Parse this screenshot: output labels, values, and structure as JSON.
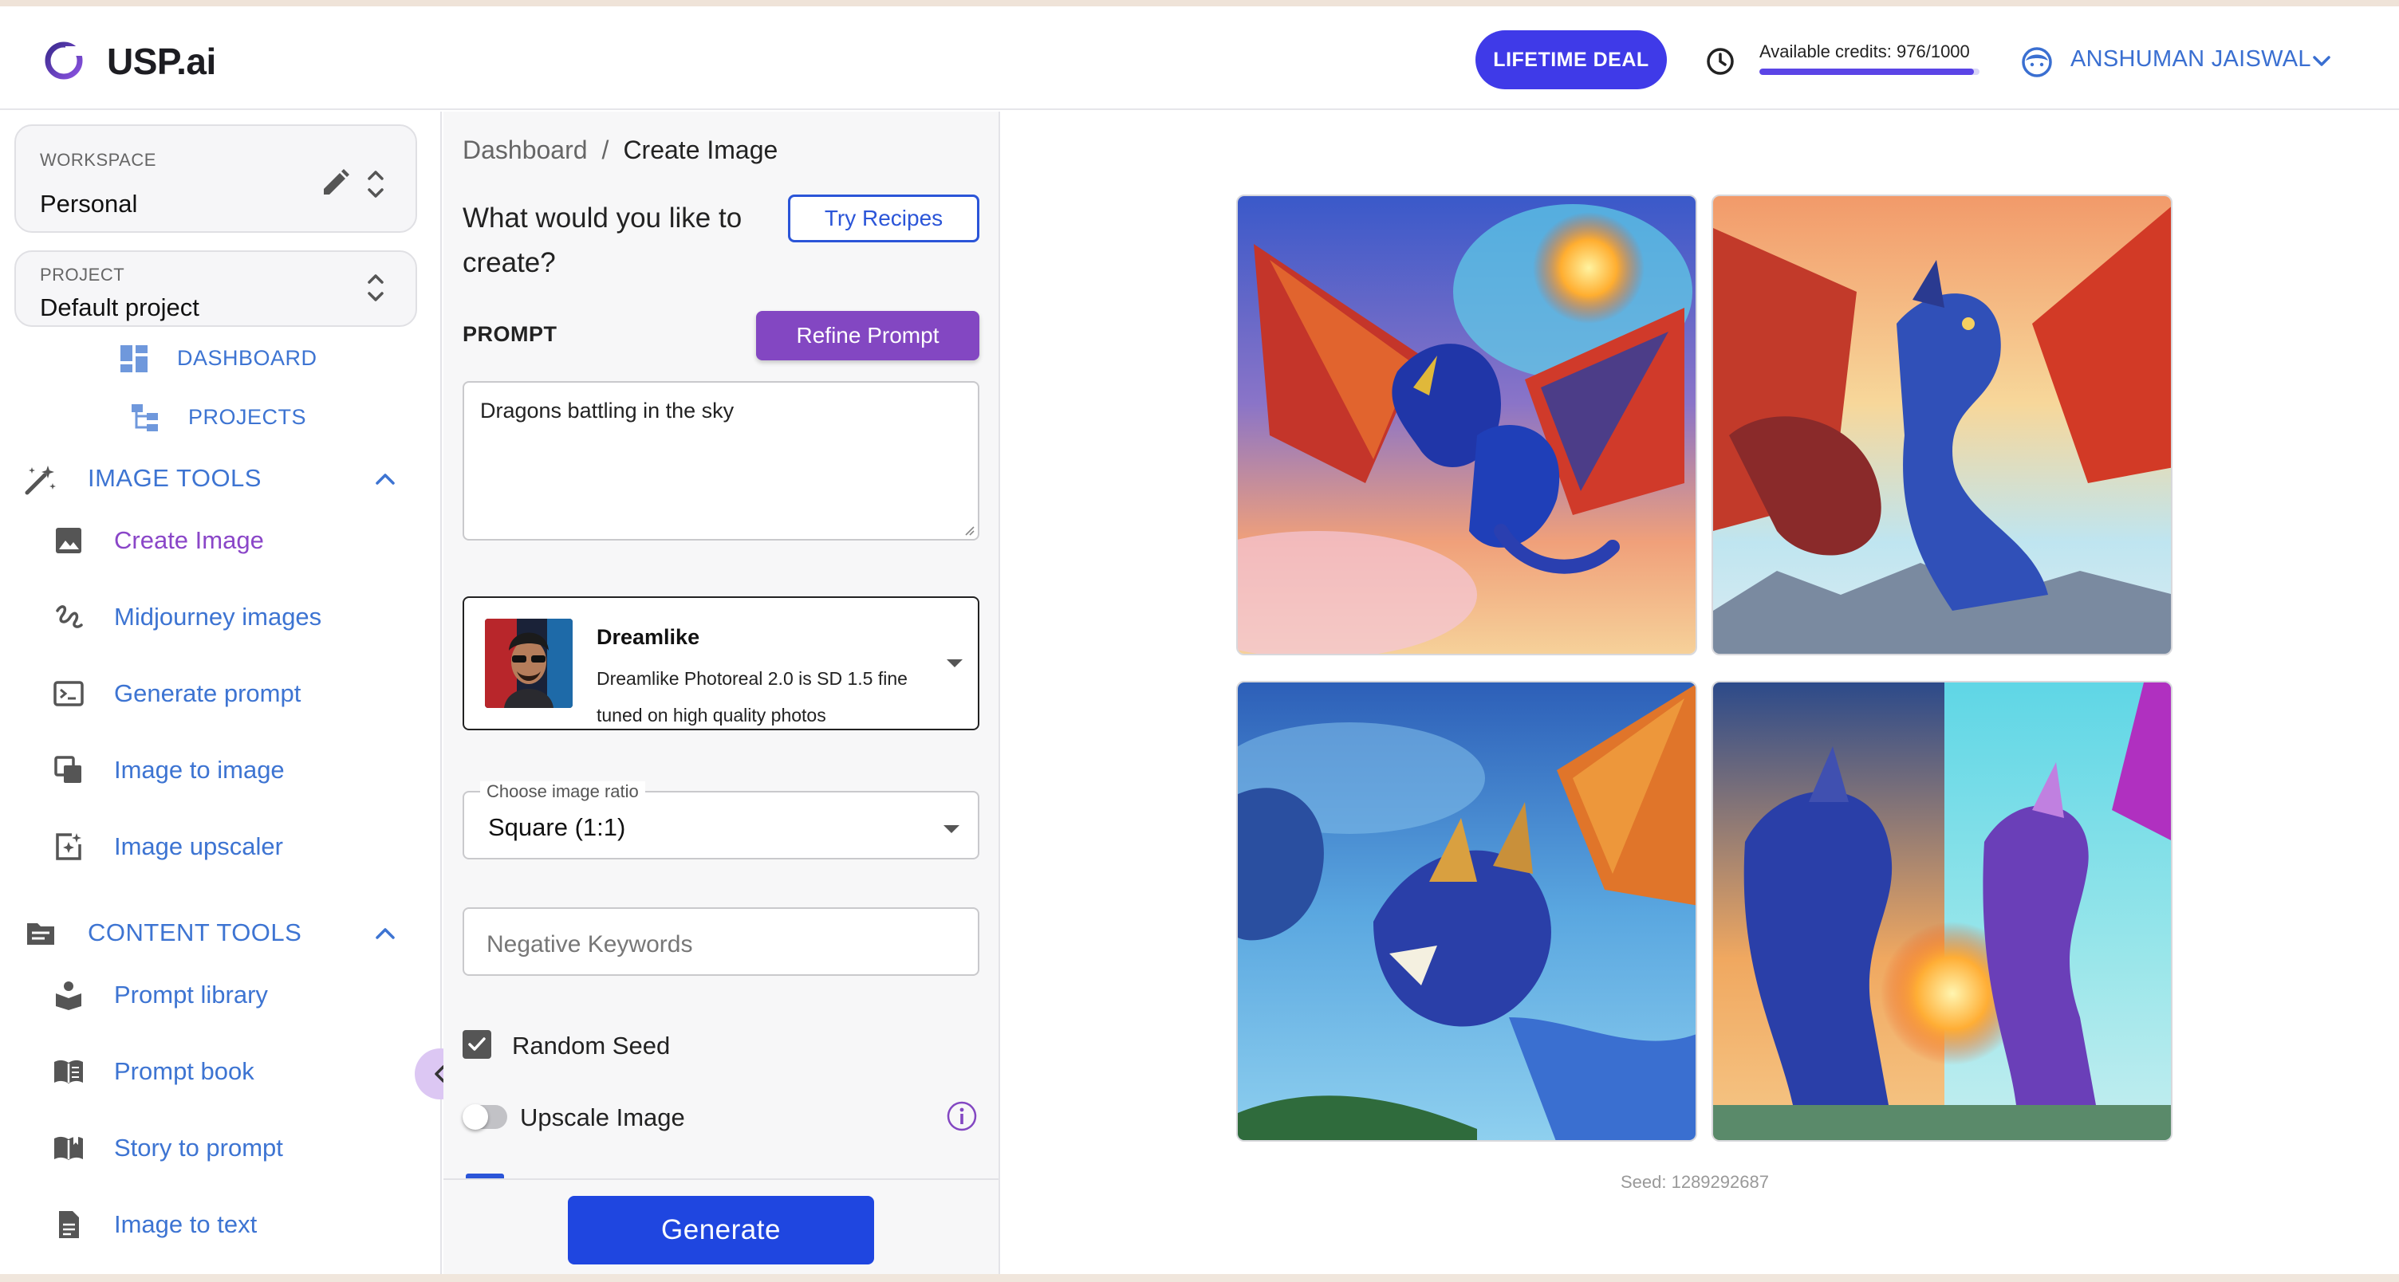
{
  "app": {
    "name": "USP.ai"
  },
  "header": {
    "deal_label": "LIFETIME DEAL",
    "credits_text": "Available credits: 976/1000",
    "credits_fraction": 0.976,
    "user_name": "ANSHUMAN JAISWAL"
  },
  "sidebar": {
    "workspace_label": "WORKSPACE",
    "workspace_value": "Personal",
    "project_label": "PROJECT",
    "project_value": "Default project",
    "links": [
      {
        "label": "DASHBOARD",
        "icon": "dashboard-icon"
      },
      {
        "label": "PROJECTS",
        "icon": "projects-icon"
      }
    ],
    "image_tools": {
      "title": "IMAGE TOOLS",
      "items": [
        {
          "label": "Create Image",
          "icon": "image-icon",
          "active": true
        },
        {
          "label": "Midjourney images",
          "icon": "squiggle-icon"
        },
        {
          "label": "Generate prompt",
          "icon": "terminal-icon"
        },
        {
          "label": "Image to image",
          "icon": "copy-image-icon"
        },
        {
          "label": "Image upscaler",
          "icon": "upscale-icon"
        }
      ]
    },
    "content_tools": {
      "title": "CONTENT TOOLS",
      "items": [
        {
          "label": "Prompt library",
          "icon": "library-icon"
        },
        {
          "label": "Prompt book",
          "icon": "book-icon"
        },
        {
          "label": "Story to prompt",
          "icon": "open-book-icon"
        },
        {
          "label": "Image to text",
          "icon": "document-icon"
        }
      ]
    }
  },
  "form": {
    "breadcrumb_root": "Dashboard",
    "breadcrumb_sep": "/",
    "breadcrumb_current": "Create Image",
    "question": "What would you like to create?",
    "recipes_label": "Try Recipes",
    "prompt_label": "PROMPT",
    "refine_label": "Refine Prompt",
    "prompt_value": "Dragons battling in the sky",
    "model_name": "Dreamlike",
    "model_desc": "Dreamlike Photoreal 2.0 is SD 1.5 fine tuned on high quality photos",
    "ratio_label": "Choose image ratio",
    "ratio_value": "Square (1:1)",
    "negative_placeholder": "Negative Keywords",
    "random_seed_label": "Random Seed",
    "random_seed_checked": true,
    "upscale_label": "Upscale Image",
    "upscale_on": false,
    "generate_label": "Generate"
  },
  "result": {
    "seed_text": "Seed: 1289292687",
    "images": [
      "dragon-image-1",
      "dragon-image-2",
      "dragon-image-3",
      "dragon-image-4"
    ]
  },
  "colors": {
    "accent_blue": "#3d74d2",
    "deal_button": "#3f3ae8",
    "refine_button": "#8347c2",
    "generate_button": "#1f46e0",
    "active_nav": "#8a46c8"
  }
}
